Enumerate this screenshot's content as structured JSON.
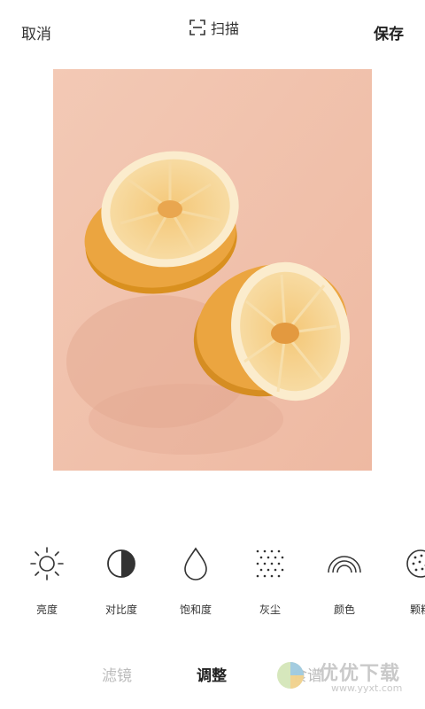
{
  "topbar": {
    "cancel_label": "取消",
    "scan_label": "扫描",
    "save_label": "保存"
  },
  "tools": [
    {
      "label": "亮度",
      "icon": "sun-icon"
    },
    {
      "label": "对比度",
      "icon": "contrast-icon"
    },
    {
      "label": "饱和度",
      "icon": "droplet-icon"
    },
    {
      "label": "灰尘",
      "icon": "dust-icon"
    },
    {
      "label": "颜色",
      "icon": "rainbow-icon"
    },
    {
      "label": "颗粒",
      "icon": "grain-icon"
    }
  ],
  "tabs": {
    "filters": "滤镜",
    "adjust": "调整",
    "recipes": "食谱"
  },
  "watermark": {
    "title": "优优下载",
    "url": "www.yyxt.com"
  },
  "colors": {
    "background": "#ffffff",
    "photo_bg": "#f1c3ae",
    "lemon": "#eba540",
    "text": "#333333",
    "inactive_tab": "#bbbbbb"
  }
}
